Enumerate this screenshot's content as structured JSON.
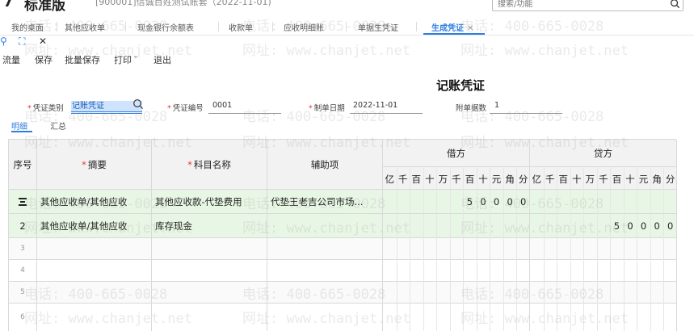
{
  "app": {
    "logo": "7",
    "title": "标准版",
    "account": "[900001]信诚百姓测试账套（2022-11-01)"
  },
  "search": {
    "placeholder": "搜索/功能"
  },
  "tabs": [
    {
      "label": "我的桌面"
    },
    {
      "label": "其他应收单"
    },
    {
      "label": "现金银行余额表"
    },
    {
      "label": "收款单"
    },
    {
      "label": "应收明细账"
    },
    {
      "label": "单据生凭证"
    },
    {
      "label": "生成凭证",
      "active": true
    }
  ],
  "window_controls": {
    "search": "⚲",
    "expand": "⛶",
    "close": "✕"
  },
  "toolbar": {
    "items": [
      "流量",
      "保存",
      "批量保存",
      "打印",
      "退出"
    ],
    "print_caret": "ˇ"
  },
  "voucher": {
    "title": "记账凭证",
    "type_label": "凭证类别",
    "type_value": "记账凭证",
    "number_label": "凭证编号",
    "number_value": "0001",
    "date_label": "制单日期",
    "date_value": "2022-11-01",
    "attach_label": "附单据数",
    "attach_value": "1"
  },
  "subtabs": {
    "detail": "明细",
    "summary": "汇总"
  },
  "table": {
    "headers": {
      "seq": "序号",
      "summary": "摘要",
      "account": "科目名称",
      "aux": "辅助项",
      "debit": "借方",
      "credit": "贷方"
    },
    "units": [
      "亿",
      "千",
      "百",
      "十",
      "万",
      "千",
      "百",
      "十",
      "元",
      "角",
      "分"
    ],
    "rows": [
      {
        "seq_icon": "insert-row-icon",
        "summary": "其他应收单/其他应收",
        "account": "其他应收款-代垫费用",
        "aux": "代垫王老吉公司市场...",
        "debit_digits": [
          "",
          "",
          "",
          "",
          "",
          "",
          "5",
          "0",
          "0",
          "0",
          "0"
        ],
        "credit_digits": [
          "",
          "",
          "",
          "",
          "",
          "",
          "",
          "",
          "",
          "",
          ""
        ]
      },
      {
        "seq": "2",
        "summary": "其他应收单/其他应收",
        "account": "库存现金",
        "aux": "",
        "debit_digits": [
          "",
          "",
          "",
          "",
          "",
          "",
          "",
          "",
          "",
          "",
          ""
        ],
        "credit_digits": [
          "",
          "",
          "",
          "",
          "",
          "",
          "5",
          "0",
          "0",
          "0",
          "0"
        ]
      },
      {
        "seq": "3"
      },
      {
        "seq": "4"
      },
      {
        "seq": "5"
      },
      {
        "seq": "6"
      }
    ]
  },
  "watermarks": {
    "phone": "电话: 400-665-0028",
    "site": "网址: www.chanjet.net"
  },
  "colors": {
    "accent": "#2f7de1",
    "required": "#e53935",
    "row_highlight": "#e8f7e5",
    "header_bg": "#f2f2f2"
  }
}
